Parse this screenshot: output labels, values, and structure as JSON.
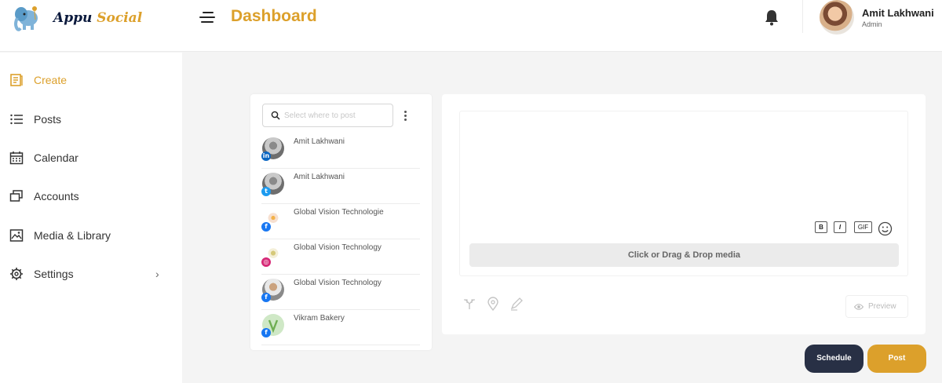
{
  "brand": {
    "name_part1": "Appu",
    "name_part2": "Social",
    "accent_color": "#dca02b",
    "dark_color": "#283045"
  },
  "header": {
    "title": "Dashboard",
    "notification_icon": "bell-icon",
    "menu_icon": "hamburger-icon"
  },
  "user": {
    "name": "Amit Lakhwani",
    "role": "Admin"
  },
  "sidebar": {
    "items": [
      {
        "label": "Create",
        "icon": "create-icon",
        "active": true
      },
      {
        "label": "Posts",
        "icon": "list-icon"
      },
      {
        "label": "Calendar",
        "icon": "calendar-icon"
      },
      {
        "label": "Accounts",
        "icon": "accounts-icon"
      },
      {
        "label": "Media & Library",
        "icon": "image-icon"
      },
      {
        "label": "Settings",
        "icon": "gear-icon",
        "has_submenu": true
      }
    ]
  },
  "accounts_panel": {
    "search_placeholder": "Select where to post",
    "accounts": [
      {
        "name": "Amit Lakhwani",
        "network": "linkedin",
        "badge": "in"
      },
      {
        "name": "Amit Lakhwani",
        "network": "twitter",
        "badge": "t"
      },
      {
        "name": "Global Vision Technologie",
        "network": "facebook",
        "badge": "f"
      },
      {
        "name": "Global Vision Technology",
        "network": "instagram",
        "badge": "◎"
      },
      {
        "name": "Global Vision Technology",
        "network": "facebook",
        "badge": "f"
      },
      {
        "name": "Vikram Bakery",
        "network": "facebook",
        "badge": "f"
      }
    ]
  },
  "composer": {
    "bold_label": "B",
    "italic_label": "I",
    "gif_label": "GIF",
    "dropzone_label": "Click or Drag & Drop media",
    "preview_label": "Preview"
  },
  "actions": {
    "schedule_label": "Schedule",
    "post_label": "Post"
  }
}
